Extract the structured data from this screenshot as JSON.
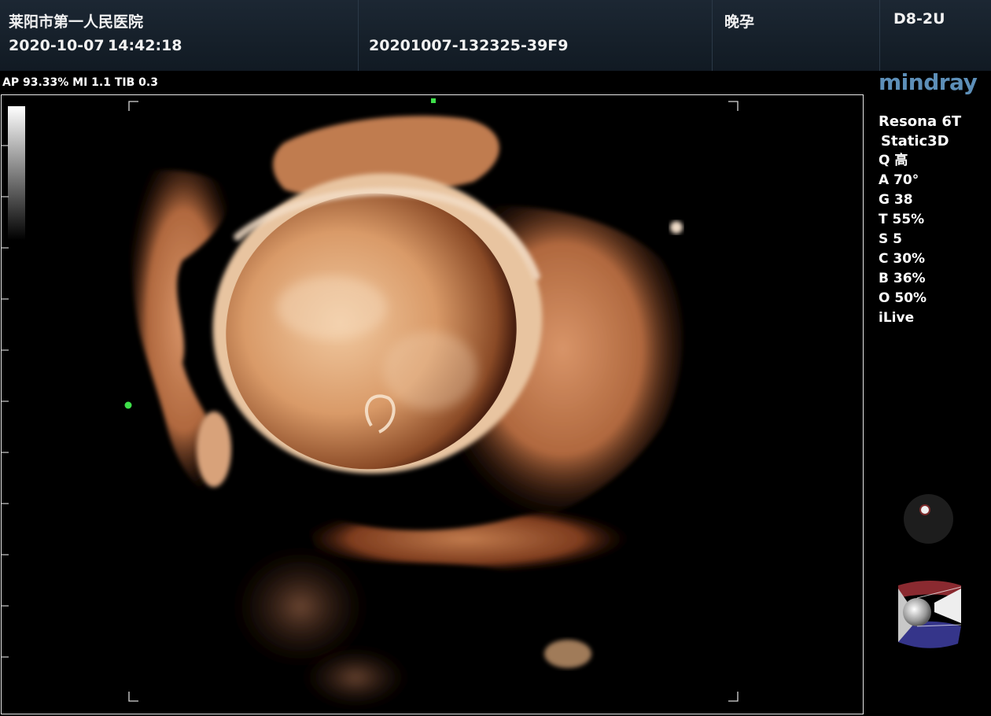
{
  "header": {
    "hospital": "莱阳市第一人民医院",
    "date": "2020-10-07",
    "time": "14:42:18",
    "exam_id": "20201007-132325-39F9",
    "exam_type": "晚孕",
    "probe": "D8-2U"
  },
  "acoustic_info": "AP 93.33%  MI 1.1 TIB 0.3",
  "brand": "mindray",
  "params": {
    "model": "Resona 6T",
    "mode": "Static3D",
    "rows": [
      "Q 高",
      "A 70°",
      "G 38",
      "T 55%",
      "S 5",
      "C 30%",
      "B 36%",
      "O 50%",
      "iLive"
    ]
  },
  "colors": {
    "header_bg": "#16202a",
    "brand_blue": "#5d8fb8",
    "marker_green": "#3ee04a",
    "render_skin": "#d9a27a"
  },
  "icons": {
    "trackball": "trackball-icon",
    "orientation": "orientation-cube-icon",
    "grayscale": "grayscale-bar-icon"
  }
}
